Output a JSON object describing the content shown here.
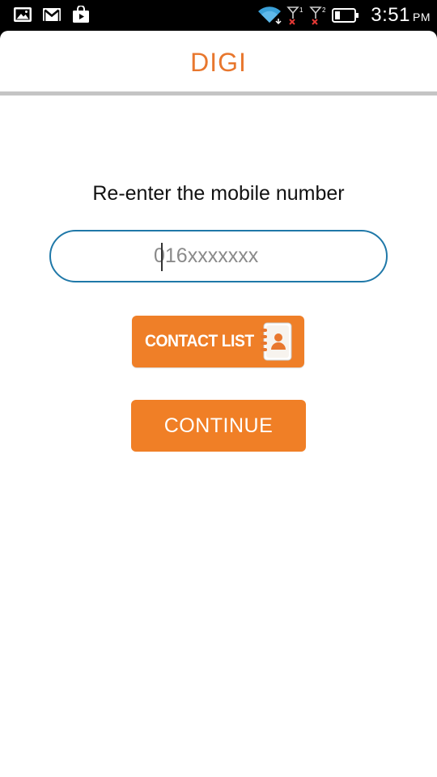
{
  "status_bar": {
    "icons": [
      "gallery-icon",
      "gmail-icon",
      "shopping-bag-icon"
    ],
    "right_icons": [
      "wifi-icon",
      "signal-sim1-icon",
      "signal-sim2-icon",
      "battery-icon"
    ],
    "sim1_label": "1",
    "sim2_label": "2",
    "time": "3:51",
    "ampm": "PM"
  },
  "header": {
    "title": "DIGI",
    "title_color": "#E8772E"
  },
  "form": {
    "prompt": "Re-enter the mobile number",
    "phone_value": "",
    "phone_placeholder": "016xxxxxxx"
  },
  "buttons": {
    "contact_list_label": "CONTACT LIST",
    "contact_list_icon": "address-book-icon",
    "continue_label": "CONTINUE",
    "accent_color": "#F07F26"
  }
}
